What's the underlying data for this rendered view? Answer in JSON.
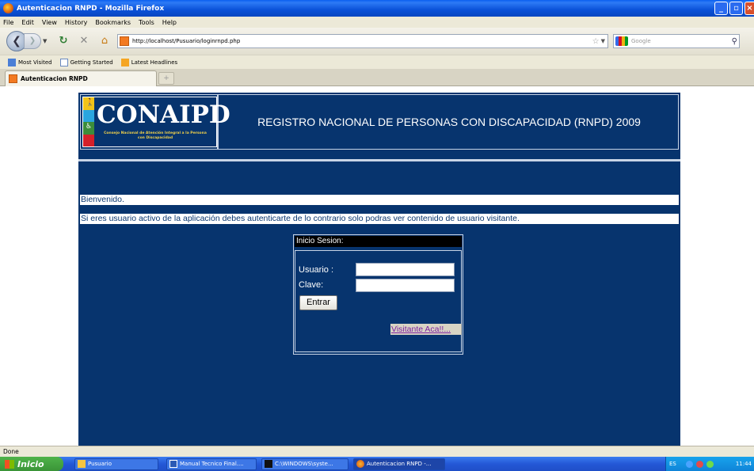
{
  "window": {
    "title": "Autenticacion RNPD - Mozilla Firefox"
  },
  "menu": [
    "File",
    "Edit",
    "View",
    "History",
    "Bookmarks",
    "Tools",
    "Help"
  ],
  "navbar": {
    "url": "http://localhost/Pusuario/loginrnpd.php",
    "search_placeholder": "Google"
  },
  "bookmarks": [
    "Most Visited",
    "Getting Started",
    "Latest Headlines"
  ],
  "tab": {
    "title": "Autenticacion RNPD",
    "new_tab_glyph": "+"
  },
  "page": {
    "logo_text": "CONAIPD",
    "logo_subtitle": "Consejo Nacional de Atención Integral a la Persona con Discapacidad",
    "header_title": "REGISTRO NACIONAL DE PERSONAS CON DISCAPACIDAD (RNPD) 2009",
    "welcome": "Bienvenido.",
    "info": "Si eres usuario activo de la aplicación debes autenticarte de lo contrario solo podras ver contenido de usuario visitante.",
    "login": {
      "heading": "Inicio Sesion:",
      "user_label": "Usuario :",
      "pass_label": "Clave:",
      "user_value": "",
      "pass_value": "",
      "submit_label": "Entrar",
      "visitor_link": "Visitante Aca!!..."
    },
    "logo_colors": [
      "#f2c318",
      "#2aa6df",
      "#3c8d3a",
      "#d4202a"
    ]
  },
  "status": "Done",
  "taskbar": {
    "start_label": "Inicio",
    "tasks": [
      {
        "label": "Pusuario",
        "icon": "folder-icon"
      },
      {
        "label": "Manual Tecnico Final....",
        "icon": "word-icon"
      },
      {
        "label": "C:\\WINDOWS\\syste...",
        "icon": "cmd-icon"
      },
      {
        "label": "Autenticacion RNPD -...",
        "icon": "firefox-icon"
      }
    ],
    "lang": "ES",
    "clock": "11:44"
  },
  "colors": {
    "page_bg": "#07346e",
    "link": "#7a1fa0"
  }
}
